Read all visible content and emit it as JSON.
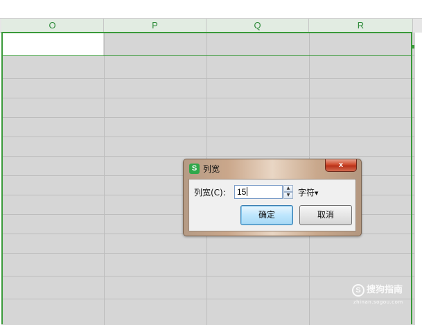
{
  "columns": [
    "O",
    "P",
    "Q",
    "R"
  ],
  "dialog": {
    "title": "列宽",
    "close_label": "x",
    "label": "列宽(C):",
    "value": "15",
    "unit": "字符",
    "ok_label": "确定",
    "cancel_label": "取消"
  },
  "watermark": {
    "text": "搜狗指南",
    "sub": "zhinan.sogou.com"
  },
  "colors": {
    "header_text": "#2e8b3a",
    "selection": "#3a9a3a",
    "app_icon": "#2fa84a",
    "close_button": "#c8452a",
    "ok_button": "#bee6fd"
  },
  "icons": {
    "app": "wps-spreadsheet-icon",
    "close": "close-icon",
    "spin_up": "spin-up-icon",
    "spin_down": "spin-down-icon",
    "unit_dropdown": "dropdown-arrow-icon"
  }
}
